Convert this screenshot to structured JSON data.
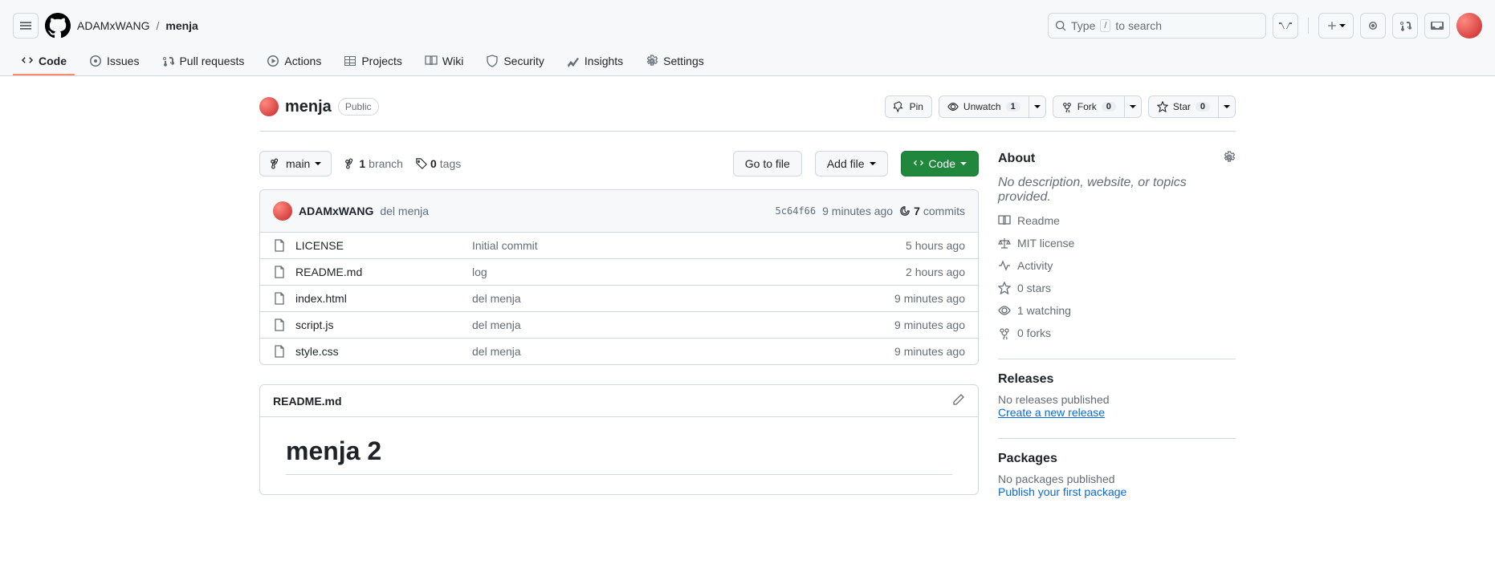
{
  "header": {
    "owner": "ADAMxWANG",
    "sep": "/",
    "repo": "menja",
    "search_placeholder_prefix": "Type",
    "search_slash": "/",
    "search_placeholder_suffix": "to search"
  },
  "nav": {
    "code": "Code",
    "issues": "Issues",
    "pulls": "Pull requests",
    "actions": "Actions",
    "projects": "Projects",
    "wiki": "Wiki",
    "security": "Security",
    "insights": "Insights",
    "settings": "Settings"
  },
  "repo": {
    "name": "menja",
    "visibility": "Public",
    "pin": "Pin",
    "unwatch": "Unwatch",
    "watch_count": "1",
    "fork": "Fork",
    "fork_count": "0",
    "star": "Star",
    "star_count": "0"
  },
  "fileNav": {
    "branch": "main",
    "branch_count": "1",
    "branch_label": "branch",
    "tag_count": "0",
    "tag_label": "tags",
    "goto": "Go to file",
    "addfile": "Add file",
    "code": "Code"
  },
  "commit": {
    "author": "ADAMxWANG",
    "message": "del menja",
    "sha": "5c64f66",
    "time": "9 minutes ago",
    "count": "7",
    "count_label": "commits"
  },
  "files": [
    {
      "name": "LICENSE",
      "msg": "Initial commit",
      "time": "5 hours ago"
    },
    {
      "name": "README.md",
      "msg": "log",
      "time": "2 hours ago"
    },
    {
      "name": "index.html",
      "msg": "del menja",
      "time": "9 minutes ago"
    },
    {
      "name": "script.js",
      "msg": "del menja",
      "time": "9 minutes ago"
    },
    {
      "name": "style.css",
      "msg": "del menja",
      "time": "9 minutes ago"
    }
  ],
  "readme": {
    "filename": "README.md",
    "content": "menja 2"
  },
  "sidebar": {
    "about": "About",
    "description": "No description, website, or topics provided.",
    "readme": "Readme",
    "license": "MIT license",
    "activity": "Activity",
    "stars": "0 stars",
    "watching": "1 watching",
    "forks": "0 forks",
    "releases_title": "Releases",
    "releases_empty": "No releases published",
    "releases_link": "Create a new release",
    "packages_title": "Packages",
    "packages_empty": "No packages published",
    "packages_link": "Publish your first package"
  }
}
